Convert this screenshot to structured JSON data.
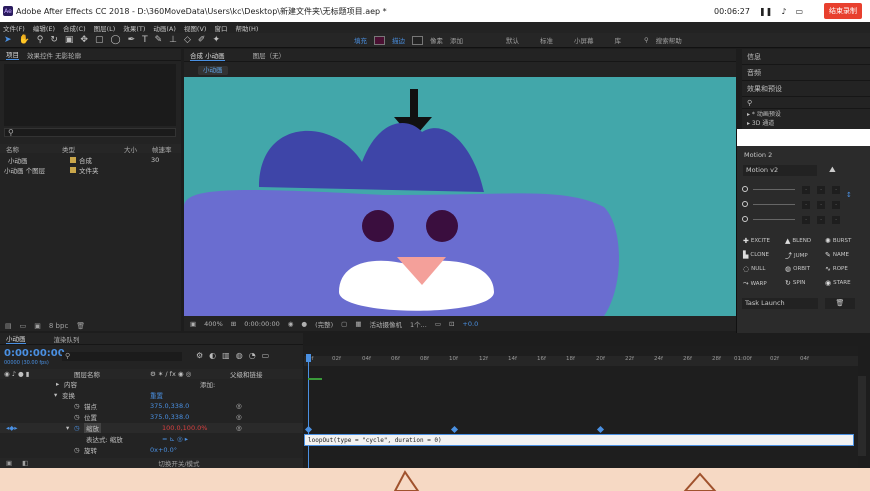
{
  "window": {
    "title": "Adobe After Effects CC 2018 - D:\\360MoveData\\Users\\kc\\Desktop\\新建文件夹\\无标题项目.aep *",
    "app_icon": "Ae"
  },
  "recorder": {
    "time": "00:06:27",
    "end_label": "结束录制"
  },
  "menu": [
    "文件(F)",
    "编辑(E)",
    "合成(C)",
    "图层(L)",
    "效果(T)",
    "动画(A)",
    "视图(V)",
    "窗口",
    "帮助(H)"
  ],
  "toolbar": {
    "fill_label": "填充",
    "stroke_label": "描边",
    "pixel_label": "像素",
    "add_label": "添加",
    "workspaces": [
      "默认",
      "标准",
      "小屏幕",
      "库"
    ],
    "search_placeholder": "搜索帮助"
  },
  "project": {
    "tabs": [
      "项目",
      "效果控件 无影轮廓"
    ],
    "search_placeholder": "",
    "columns": [
      "名称",
      "类型",
      "大小",
      "帧速率"
    ],
    "items": [
      {
        "name": "小动画",
        "type": "合成",
        "fps": "30",
        "color": "#c9a64a"
      },
      {
        "name": "小动画 个图层",
        "type": "文件夹",
        "fps": "",
        "color": "#c9a64a"
      }
    ],
    "bpc_label": "8 bpc"
  },
  "composition": {
    "tabs": [
      "合成 小动画",
      "图层（无）"
    ],
    "sub_tab": "小动画",
    "zoom": "400%",
    "timecode": "0:00:00:00",
    "quality": "(完整)",
    "camera": "活动摄像机",
    "views": "1个...",
    "exposure": "+0.0"
  },
  "right_panels": {
    "sections": [
      "信息",
      "音频",
      "效果和预设"
    ],
    "search_placeholder": "",
    "items": [
      "▸ * 动画预设",
      "▸ 3D 通道"
    ]
  },
  "motion": {
    "title": "Motion 2",
    "version": "Motion v2",
    "buttons": [
      {
        "label": "EXCITE",
        "icon": "✚"
      },
      {
        "label": "BLEND",
        "icon": "▲"
      },
      {
        "label": "BURST",
        "icon": "✺"
      },
      {
        "label": "CLONE",
        "icon": "▙"
      },
      {
        "label": "JUMP",
        "icon": "⤴"
      },
      {
        "label": "NAME",
        "icon": "✎"
      },
      {
        "label": "NULL",
        "icon": "◌"
      },
      {
        "label": "ORBIT",
        "icon": "◍"
      },
      {
        "label": "ROPE",
        "icon": "∿"
      },
      {
        "label": "WARP",
        "icon": "⤳"
      },
      {
        "label": "SPIN",
        "icon": "↻"
      },
      {
        "label": "STARE",
        "icon": "◉"
      }
    ],
    "task": "Task Launch"
  },
  "timeline": {
    "tabs": [
      "小动画",
      "渲染队列"
    ],
    "timecode": "0:00:00:00",
    "timecode_sub": "00000 (30.00 fps)",
    "search_placeholder": "",
    "columns": [
      "图层名称",
      "父级和链接"
    ],
    "mode_label": "无",
    "rows": [
      {
        "label": "内容",
        "value": "",
        "indent": 60,
        "extra": "添加:"
      },
      {
        "label": "变换",
        "value": "重置",
        "indent": 58
      },
      {
        "label": "锚点",
        "value": "375.0,338.0",
        "indent": 84
      },
      {
        "label": "位置",
        "value": "375.0,338.0",
        "indent": 84
      },
      {
        "label": "缩放",
        "value": "100.0,100.0%",
        "indent": 84,
        "red": true
      },
      {
        "label": "表达式: 缩放",
        "value": "",
        "indent": 86
      },
      {
        "label": "旋转",
        "value": "0x+0.0°",
        "indent": 84
      }
    ],
    "ruler": [
      "0f",
      "02f",
      "04f",
      "06f",
      "08f",
      "10f",
      "12f",
      "14f",
      "16f",
      "18f",
      "20f",
      "22f",
      "24f",
      "26f",
      "28f",
      "01:00f",
      "02f",
      "04f"
    ],
    "expression": "loopOut(type = \"cycle\", duration = 0)",
    "foot_label": "切换开关/模式"
  }
}
